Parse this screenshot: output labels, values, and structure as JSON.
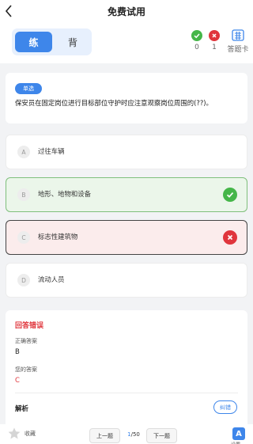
{
  "header": {
    "title": "免费试用"
  },
  "mode": {
    "practice_label": "练",
    "memorize_label": "背"
  },
  "stats": {
    "correct_count": "0",
    "wrong_count": "1",
    "answer_card_label": "答题卡"
  },
  "question": {
    "type_tag": "单选",
    "text": "保安员在固定岗位进行目标部位守护时应注意观察岗位周围的(??)。"
  },
  "options": [
    {
      "letter": "A",
      "text": "过往车辆",
      "state": "normal"
    },
    {
      "letter": "B",
      "text": "地形、地物和设备",
      "state": "correct"
    },
    {
      "letter": "C",
      "text": "标志性建筑物",
      "state": "wrong"
    },
    {
      "letter": "D",
      "text": "流动人员",
      "state": "normal"
    }
  ],
  "result": {
    "title": "回答错误",
    "correct_answer_label": "正确答案",
    "correct_answer": "B",
    "your_answer_label": "您的答案",
    "your_answer": "C",
    "analysis_label": "解析",
    "report_label": "纠错"
  },
  "footer": {
    "favorite_label": "收藏",
    "prev_label": "上一题",
    "current_page": "1",
    "total_pages": "/50",
    "next_label": "下一题",
    "font_label": "设置",
    "font_icon_letter": "A"
  },
  "colors": {
    "accent": "#3e86ea",
    "correct": "#45b649",
    "wrong": "#e0353c"
  }
}
